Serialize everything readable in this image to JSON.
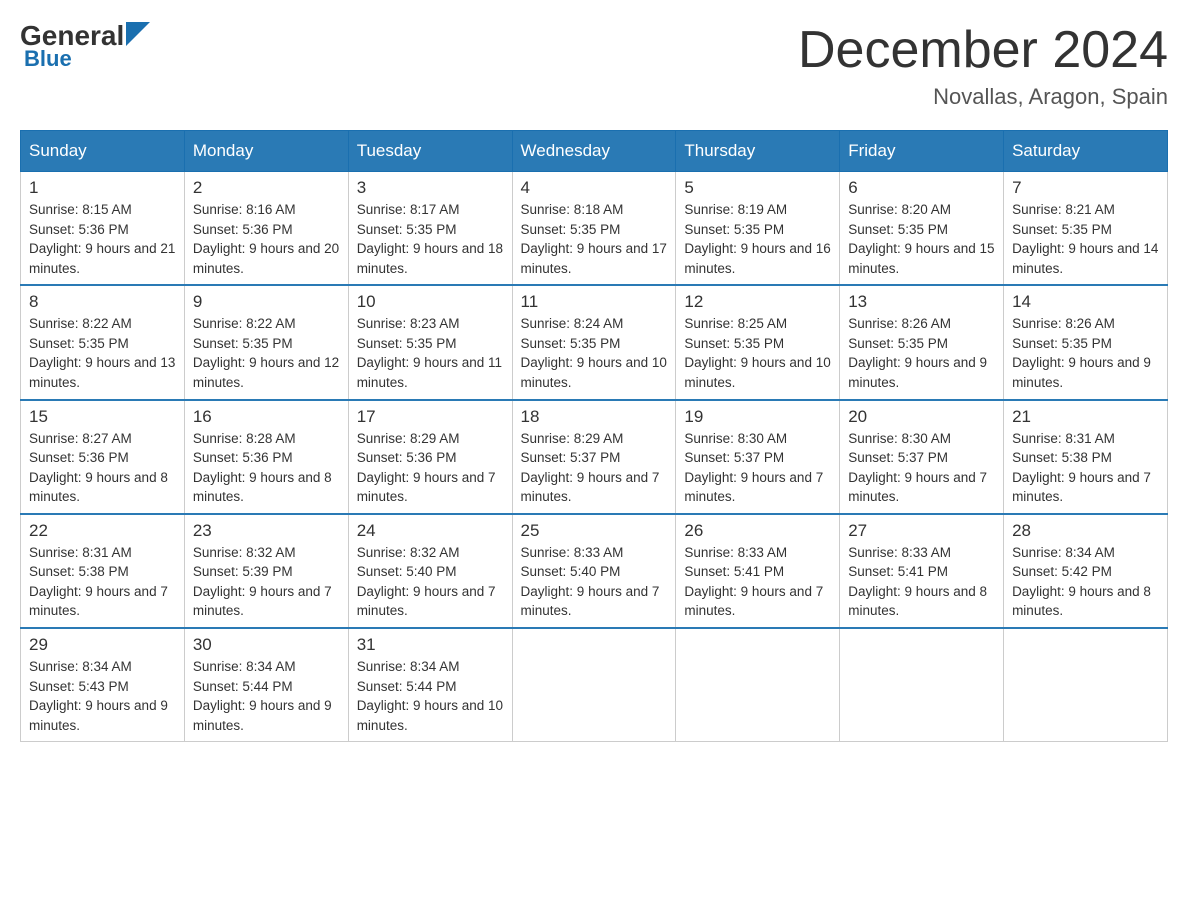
{
  "header": {
    "logo_general": "General",
    "logo_blue": "Blue",
    "month_title": "December 2024",
    "location": "Novallas, Aragon, Spain"
  },
  "weekdays": [
    "Sunday",
    "Monday",
    "Tuesday",
    "Wednesday",
    "Thursday",
    "Friday",
    "Saturday"
  ],
  "weeks": [
    [
      {
        "day": "1",
        "sunrise": "8:15 AM",
        "sunset": "5:36 PM",
        "daylight": "9 hours and 21 minutes."
      },
      {
        "day": "2",
        "sunrise": "8:16 AM",
        "sunset": "5:36 PM",
        "daylight": "9 hours and 20 minutes."
      },
      {
        "day": "3",
        "sunrise": "8:17 AM",
        "sunset": "5:35 PM",
        "daylight": "9 hours and 18 minutes."
      },
      {
        "day": "4",
        "sunrise": "8:18 AM",
        "sunset": "5:35 PM",
        "daylight": "9 hours and 17 minutes."
      },
      {
        "day": "5",
        "sunrise": "8:19 AM",
        "sunset": "5:35 PM",
        "daylight": "9 hours and 16 minutes."
      },
      {
        "day": "6",
        "sunrise": "8:20 AM",
        "sunset": "5:35 PM",
        "daylight": "9 hours and 15 minutes."
      },
      {
        "day": "7",
        "sunrise": "8:21 AM",
        "sunset": "5:35 PM",
        "daylight": "9 hours and 14 minutes."
      }
    ],
    [
      {
        "day": "8",
        "sunrise": "8:22 AM",
        "sunset": "5:35 PM",
        "daylight": "9 hours and 13 minutes."
      },
      {
        "day": "9",
        "sunrise": "8:22 AM",
        "sunset": "5:35 PM",
        "daylight": "9 hours and 12 minutes."
      },
      {
        "day": "10",
        "sunrise": "8:23 AM",
        "sunset": "5:35 PM",
        "daylight": "9 hours and 11 minutes."
      },
      {
        "day": "11",
        "sunrise": "8:24 AM",
        "sunset": "5:35 PM",
        "daylight": "9 hours and 10 minutes."
      },
      {
        "day": "12",
        "sunrise": "8:25 AM",
        "sunset": "5:35 PM",
        "daylight": "9 hours and 10 minutes."
      },
      {
        "day": "13",
        "sunrise": "8:26 AM",
        "sunset": "5:35 PM",
        "daylight": "9 hours and 9 minutes."
      },
      {
        "day": "14",
        "sunrise": "8:26 AM",
        "sunset": "5:35 PM",
        "daylight": "9 hours and 9 minutes."
      }
    ],
    [
      {
        "day": "15",
        "sunrise": "8:27 AM",
        "sunset": "5:36 PM",
        "daylight": "9 hours and 8 minutes."
      },
      {
        "day": "16",
        "sunrise": "8:28 AM",
        "sunset": "5:36 PM",
        "daylight": "9 hours and 8 minutes."
      },
      {
        "day": "17",
        "sunrise": "8:29 AM",
        "sunset": "5:36 PM",
        "daylight": "9 hours and 7 minutes."
      },
      {
        "day": "18",
        "sunrise": "8:29 AM",
        "sunset": "5:37 PM",
        "daylight": "9 hours and 7 minutes."
      },
      {
        "day": "19",
        "sunrise": "8:30 AM",
        "sunset": "5:37 PM",
        "daylight": "9 hours and 7 minutes."
      },
      {
        "day": "20",
        "sunrise": "8:30 AM",
        "sunset": "5:37 PM",
        "daylight": "9 hours and 7 minutes."
      },
      {
        "day": "21",
        "sunrise": "8:31 AM",
        "sunset": "5:38 PM",
        "daylight": "9 hours and 7 minutes."
      }
    ],
    [
      {
        "day": "22",
        "sunrise": "8:31 AM",
        "sunset": "5:38 PM",
        "daylight": "9 hours and 7 minutes."
      },
      {
        "day": "23",
        "sunrise": "8:32 AM",
        "sunset": "5:39 PM",
        "daylight": "9 hours and 7 minutes."
      },
      {
        "day": "24",
        "sunrise": "8:32 AM",
        "sunset": "5:40 PM",
        "daylight": "9 hours and 7 minutes."
      },
      {
        "day": "25",
        "sunrise": "8:33 AM",
        "sunset": "5:40 PM",
        "daylight": "9 hours and 7 minutes."
      },
      {
        "day": "26",
        "sunrise": "8:33 AM",
        "sunset": "5:41 PM",
        "daylight": "9 hours and 7 minutes."
      },
      {
        "day": "27",
        "sunrise": "8:33 AM",
        "sunset": "5:41 PM",
        "daylight": "9 hours and 8 minutes."
      },
      {
        "day": "28",
        "sunrise": "8:34 AM",
        "sunset": "5:42 PM",
        "daylight": "9 hours and 8 minutes."
      }
    ],
    [
      {
        "day": "29",
        "sunrise": "8:34 AM",
        "sunset": "5:43 PM",
        "daylight": "9 hours and 9 minutes."
      },
      {
        "day": "30",
        "sunrise": "8:34 AM",
        "sunset": "5:44 PM",
        "daylight": "9 hours and 9 minutes."
      },
      {
        "day": "31",
        "sunrise": "8:34 AM",
        "sunset": "5:44 PM",
        "daylight": "9 hours and 10 minutes."
      },
      null,
      null,
      null,
      null
    ]
  ]
}
